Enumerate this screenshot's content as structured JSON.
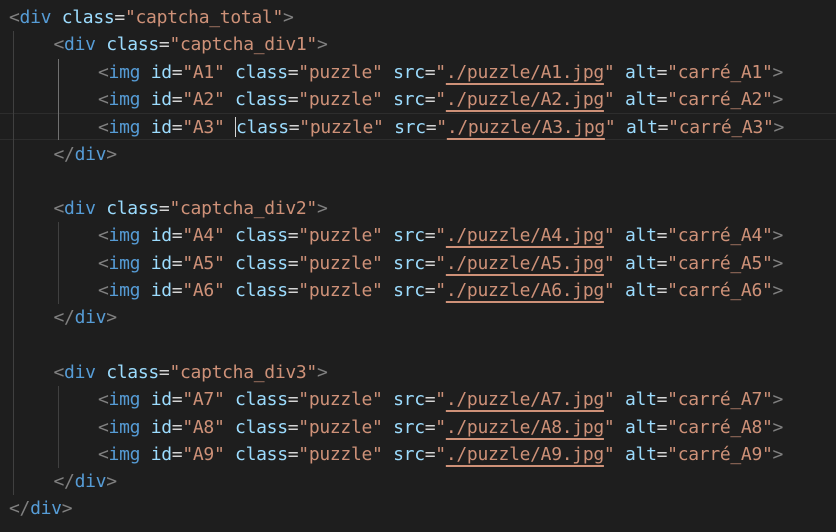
{
  "editor": {
    "language": "html",
    "theme": {
      "background": "#1e1e1e",
      "tag_color": "#569cd6",
      "attribute_color": "#9cdcfe",
      "string_color": "#ce9178",
      "bracket_color": "#808080",
      "text_color": "#d4d4d4"
    },
    "cursor": {
      "line": 4,
      "before_text": "class"
    },
    "lines": [
      {
        "indent": 0,
        "kind": "open_div",
        "tag": "div",
        "class_attr": "class",
        "class_value": "captcha_total"
      },
      {
        "indent": 1,
        "kind": "open_div",
        "tag": "div",
        "class_attr": "class",
        "class_value": "captcha_div1"
      },
      {
        "indent": 2,
        "kind": "img",
        "tag": "img",
        "id": "A1",
        "class_value": "puzzle",
        "src": "./puzzle/A1.jpg",
        "alt": "carré_A1"
      },
      {
        "indent": 2,
        "kind": "img",
        "tag": "img",
        "id": "A2",
        "class_value": "puzzle",
        "src": "./puzzle/A2.jpg",
        "alt": "carré_A2"
      },
      {
        "indent": 2,
        "kind": "img",
        "tag": "img",
        "id": "A3",
        "class_value": "puzzle",
        "src": "./puzzle/A3.jpg",
        "alt": "carré_A3"
      },
      {
        "indent": 1,
        "kind": "close_div",
        "tag": "div"
      },
      {
        "indent": 0,
        "kind": "blank"
      },
      {
        "indent": 1,
        "kind": "open_div",
        "tag": "div",
        "class_attr": "class",
        "class_value": "captcha_div2"
      },
      {
        "indent": 2,
        "kind": "img",
        "tag": "img",
        "id": "A4",
        "class_value": "puzzle",
        "src": "./puzzle/A4.jpg",
        "alt": "carré_A4"
      },
      {
        "indent": 2,
        "kind": "img",
        "tag": "img",
        "id": "A5",
        "class_value": "puzzle",
        "src": "./puzzle/A5.jpg",
        "alt": "carré_A5"
      },
      {
        "indent": 2,
        "kind": "img",
        "tag": "img",
        "id": "A6",
        "class_value": "puzzle",
        "src": "./puzzle/A6.jpg",
        "alt": "carré_A6"
      },
      {
        "indent": 1,
        "kind": "close_div",
        "tag": "div"
      },
      {
        "indent": 0,
        "kind": "blank"
      },
      {
        "indent": 1,
        "kind": "open_div",
        "tag": "div",
        "class_attr": "class",
        "class_value": "captcha_div3"
      },
      {
        "indent": 2,
        "kind": "img",
        "tag": "img",
        "id": "A7",
        "class_value": "puzzle",
        "src": "./puzzle/A7.jpg",
        "alt": "carré_A7"
      },
      {
        "indent": 2,
        "kind": "img",
        "tag": "img",
        "id": "A8",
        "class_value": "puzzle",
        "src": "./puzzle/A8.jpg",
        "alt": "carré_A8"
      },
      {
        "indent": 2,
        "kind": "img",
        "tag": "img",
        "id": "A9",
        "class_value": "puzzle",
        "src": "./puzzle/A9.jpg",
        "alt": "carré_A9"
      },
      {
        "indent": 1,
        "kind": "close_div",
        "tag": "div"
      },
      {
        "indent": 0,
        "kind": "close_div",
        "tag": "div"
      }
    ]
  }
}
